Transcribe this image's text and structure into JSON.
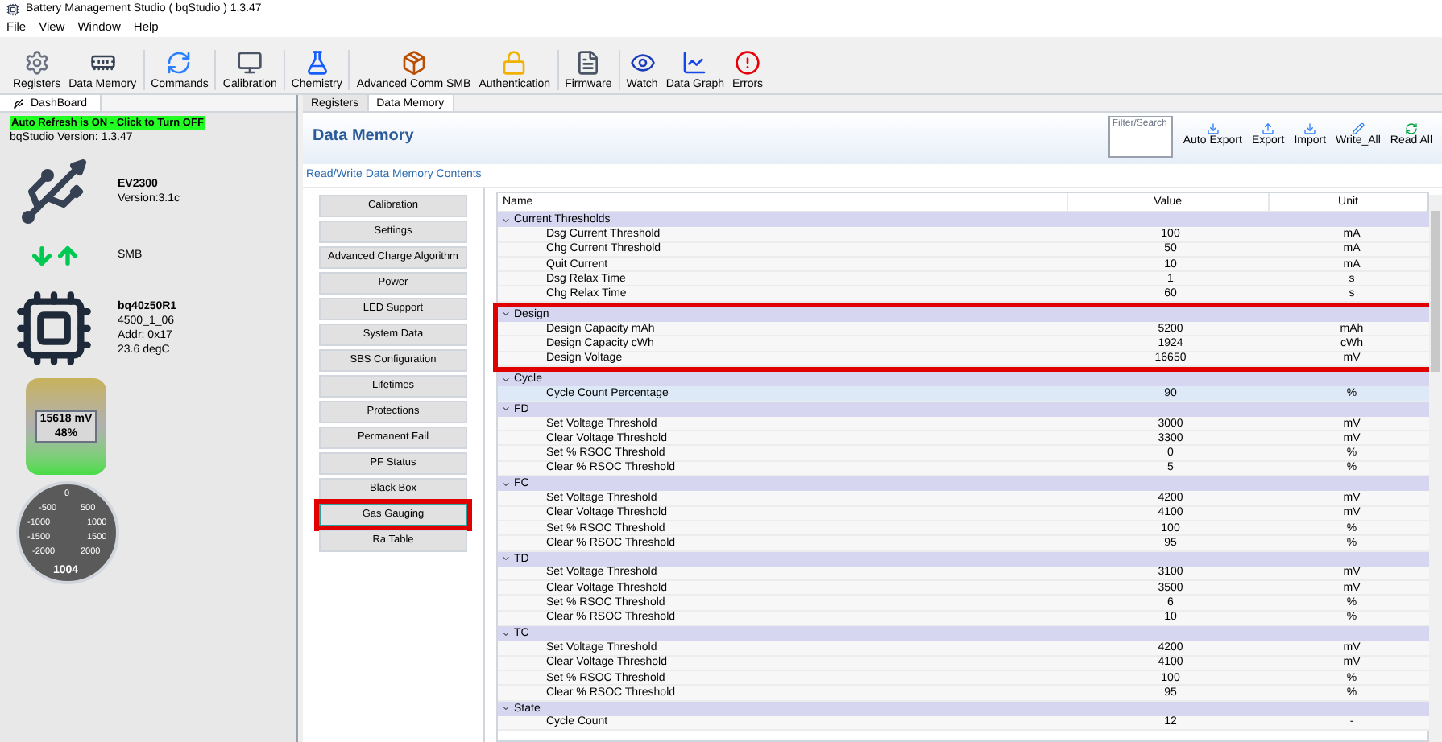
{
  "window": {
    "title": "Battery Management Studio ( bqStudio ) 1.3.47"
  },
  "menu": [
    "File",
    "View",
    "Window",
    "Help"
  ],
  "toolbar": [
    [
      "Registers",
      "Data Memory"
    ],
    [
      "Commands"
    ],
    [
      "Calibration"
    ],
    [
      "Chemistry"
    ],
    [
      "Advanced Comm SMB",
      "Authentication"
    ],
    [
      "Firmware"
    ],
    [
      "Watch",
      "Data Graph",
      "Errors"
    ]
  ],
  "dashboard": {
    "tab": "DashBoard",
    "refresh": "Auto Refresh is ON - Click to Turn OFF",
    "version": "bqStudio Version:  1.3.47",
    "adapter": {
      "name": "EV2300",
      "detail": "Version:3.1c"
    },
    "bus": "SMB",
    "device": {
      "name": "bq40z50R1",
      "lines": [
        "4500_1_06",
        "Addr: 0x17",
        "23.6 degC"
      ]
    },
    "battery": {
      "voltage": "15618 mV",
      "percent": "48%"
    },
    "gauge": {
      "ticks": [
        "0",
        "-500",
        "500",
        "-1000",
        "1000",
        "-1500",
        "1500",
        "-2000",
        "2000"
      ],
      "reading": "1004"
    }
  },
  "editor_tabs": [
    {
      "label": "Registers",
      "selected": false
    },
    {
      "label": "Data Memory",
      "selected": true
    }
  ],
  "data_memory": {
    "title": "Data Memory",
    "filter": {
      "placeholder": "Filter/Search"
    },
    "actions": [
      "Auto Export",
      "Export",
      "Import",
      "Write_All",
      "Read All"
    ],
    "subtitle": "Read/Write Data Memory Contents",
    "categories": [
      {
        "label": "Calibration",
        "selected": false,
        "highlighted": false
      },
      {
        "label": "Settings",
        "selected": false,
        "highlighted": false
      },
      {
        "label": "Advanced Charge Algorithm",
        "selected": false,
        "highlighted": false
      },
      {
        "label": "Power",
        "selected": false,
        "highlighted": false
      },
      {
        "label": "LED Support",
        "selected": false,
        "highlighted": false
      },
      {
        "label": "System Data",
        "selected": false,
        "highlighted": false
      },
      {
        "label": "SBS Configuration",
        "selected": false,
        "highlighted": false
      },
      {
        "label": "Lifetimes",
        "selected": false,
        "highlighted": false
      },
      {
        "label": "Protections",
        "selected": false,
        "highlighted": false
      },
      {
        "label": "Permanent Fail",
        "selected": false,
        "highlighted": false
      },
      {
        "label": "PF Status",
        "selected": false,
        "highlighted": false
      },
      {
        "label": "Black Box",
        "selected": false,
        "highlighted": false
      },
      {
        "label": "Gas Gauging",
        "selected": true,
        "highlighted": true
      },
      {
        "label": "Ra Table",
        "selected": false,
        "highlighted": false
      }
    ],
    "columns": [
      "Name",
      "Value",
      "Unit"
    ],
    "groups": [
      {
        "name": "Current Thresholds",
        "expanded": true,
        "highlighted": false,
        "rows": [
          {
            "name": "Dsg Current Threshold",
            "value": "100",
            "unit": "mA",
            "selected": false
          },
          {
            "name": "Chg Current Threshold",
            "value": "50",
            "unit": "mA",
            "selected": false
          },
          {
            "name": "Quit Current",
            "value": "10",
            "unit": "mA",
            "selected": false
          },
          {
            "name": "Dsg Relax Time",
            "value": "1",
            "unit": "s",
            "selected": false
          },
          {
            "name": "Chg Relax Time",
            "value": "60",
            "unit": "s",
            "selected": false
          }
        ]
      },
      {
        "name": "Design",
        "expanded": true,
        "highlighted": true,
        "rows": [
          {
            "name": "Design Capacity mAh",
            "value": "5200",
            "unit": "mAh",
            "selected": false
          },
          {
            "name": "Design Capacity cWh",
            "value": "1924",
            "unit": "cWh",
            "selected": false
          },
          {
            "name": "Design Voltage",
            "value": "16650",
            "unit": "mV",
            "selected": false
          }
        ]
      },
      {
        "name": "Cycle",
        "expanded": true,
        "highlighted": false,
        "rows": [
          {
            "name": "Cycle Count Percentage",
            "value": "90",
            "unit": "%",
            "selected": true
          }
        ]
      },
      {
        "name": "FD",
        "expanded": true,
        "highlighted": false,
        "rows": [
          {
            "name": "Set Voltage Threshold",
            "value": "3000",
            "unit": "mV",
            "selected": false
          },
          {
            "name": "Clear Voltage Threshold",
            "value": "3300",
            "unit": "mV",
            "selected": false
          },
          {
            "name": "Set % RSOC Threshold",
            "value": "0",
            "unit": "%",
            "selected": false
          },
          {
            "name": "Clear % RSOC Threshold",
            "value": "5",
            "unit": "%",
            "selected": false
          }
        ]
      },
      {
        "name": "FC",
        "expanded": true,
        "highlighted": false,
        "rows": [
          {
            "name": "Set Voltage Threshold",
            "value": "4200",
            "unit": "mV",
            "selected": false
          },
          {
            "name": "Clear Voltage Threshold",
            "value": "4100",
            "unit": "mV",
            "selected": false
          },
          {
            "name": "Set % RSOC Threshold",
            "value": "100",
            "unit": "%",
            "selected": false
          },
          {
            "name": "Clear % RSOC Threshold",
            "value": "95",
            "unit": "%",
            "selected": false
          }
        ]
      },
      {
        "name": "TD",
        "expanded": true,
        "highlighted": false,
        "rows": [
          {
            "name": "Set Voltage Threshold",
            "value": "3100",
            "unit": "mV",
            "selected": false
          },
          {
            "name": "Clear Voltage Threshold",
            "value": "3500",
            "unit": "mV",
            "selected": false
          },
          {
            "name": "Set % RSOC Threshold",
            "value": "6",
            "unit": "%",
            "selected": false
          },
          {
            "name": "Clear % RSOC Threshold",
            "value": "10",
            "unit": "%",
            "selected": false
          }
        ]
      },
      {
        "name": "TC",
        "expanded": true,
        "highlighted": false,
        "rows": [
          {
            "name": "Set Voltage Threshold",
            "value": "4200",
            "unit": "mV",
            "selected": false
          },
          {
            "name": "Clear Voltage Threshold",
            "value": "4100",
            "unit": "mV",
            "selected": false
          },
          {
            "name": "Set % RSOC Threshold",
            "value": "100",
            "unit": "%",
            "selected": false
          },
          {
            "name": "Clear % RSOC Threshold",
            "value": "95",
            "unit": "%",
            "selected": false
          }
        ]
      },
      {
        "name": "State",
        "expanded": true,
        "highlighted": false,
        "rows": [
          {
            "name": "Cycle Count",
            "value": "12",
            "unit": "-",
            "selected": false
          }
        ]
      }
    ]
  }
}
